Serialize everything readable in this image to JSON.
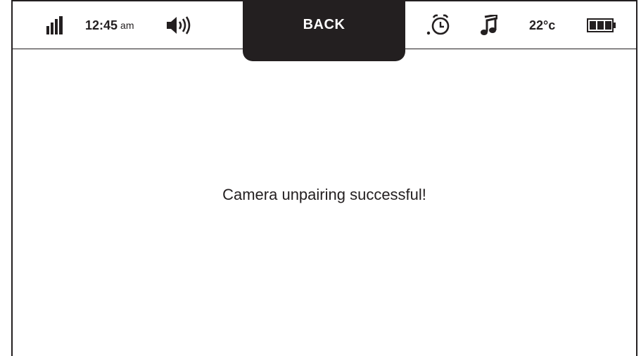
{
  "status_bar": {
    "time": "12:45",
    "time_suffix": "am",
    "temperature": "22°c",
    "icons": {
      "signal": "signal-bars-icon",
      "volume": "speaker-volume-icon",
      "alarm": "alarm-clock-icon",
      "music": "music-note-icon",
      "battery": "battery-full-icon"
    }
  },
  "back_button": {
    "label": "BACK"
  },
  "main": {
    "message": "Camera unpairing successful!"
  },
  "colors": {
    "foreground": "#231f20",
    "background": "#ffffff",
    "button_text": "#ffffff"
  }
}
